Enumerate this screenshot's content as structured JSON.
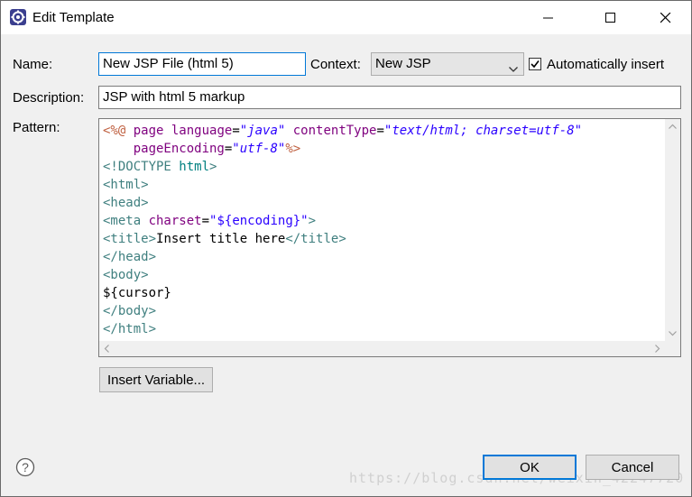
{
  "window": {
    "title": "Edit Template",
    "icon": "eclipse-gear-icon"
  },
  "form": {
    "name_label": "Name:",
    "name_value": "New JSP File (html 5)",
    "context_label": "Context:",
    "context_value": "New JSP",
    "auto_insert_label": "Automatically insert",
    "auto_insert_checked": true,
    "description_label": "Description:",
    "description_value": "JSP with html 5 markup",
    "pattern_label": "Pattern:"
  },
  "pattern": {
    "lines": [
      [
        {
          "t": "<%@ ",
          "c": "jsp"
        },
        {
          "t": "page ",
          "c": "attr"
        },
        {
          "t": "language",
          "c": "attr"
        },
        {
          "t": "=",
          "c": "plain"
        },
        {
          "t": "\"java\"",
          "c": "val"
        },
        {
          "t": " contentType",
          "c": "attr"
        },
        {
          "t": "=",
          "c": "plain"
        },
        {
          "t": "\"text/html; charset=utf-8\"",
          "c": "val"
        }
      ],
      [
        {
          "t": "    pageEncoding",
          "c": "attr"
        },
        {
          "t": "=",
          "c": "plain"
        },
        {
          "t": "\"utf-8\"",
          "c": "val"
        },
        {
          "t": "%>",
          "c": "jsp"
        }
      ],
      [
        {
          "t": "<!DOCTYPE ",
          "c": "tag"
        },
        {
          "t": "html",
          "c": "dtd"
        },
        {
          "t": ">",
          "c": "tag"
        }
      ],
      [
        {
          "t": "<html>",
          "c": "tag"
        }
      ],
      [
        {
          "t": "<head>",
          "c": "tag"
        }
      ],
      [
        {
          "t": "<meta ",
          "c": "tag"
        },
        {
          "t": "charset",
          "c": "attr"
        },
        {
          "t": "=",
          "c": "plain"
        },
        {
          "t": "\"${encoding}\"",
          "c": "str"
        },
        {
          "t": ">",
          "c": "tag"
        }
      ],
      [
        {
          "t": "<title>",
          "c": "tag"
        },
        {
          "t": "Insert title here",
          "c": "plain"
        },
        {
          "t": "</title>",
          "c": "tag"
        }
      ],
      [
        {
          "t": "</head>",
          "c": "tag"
        }
      ],
      [
        {
          "t": "<body>",
          "c": "tag"
        }
      ],
      [
        {
          "t": "${cursor}",
          "c": "plain"
        }
      ],
      [
        {
          "t": "</body>",
          "c": "tag"
        }
      ],
      [
        {
          "t": "</html>",
          "c": "tag"
        }
      ]
    ]
  },
  "buttons": {
    "insert_variable": "Insert Variable...",
    "ok": "OK",
    "cancel": "Cancel",
    "help": "?"
  },
  "watermark": "https://blog.csdn.net/weixin_42247720"
}
